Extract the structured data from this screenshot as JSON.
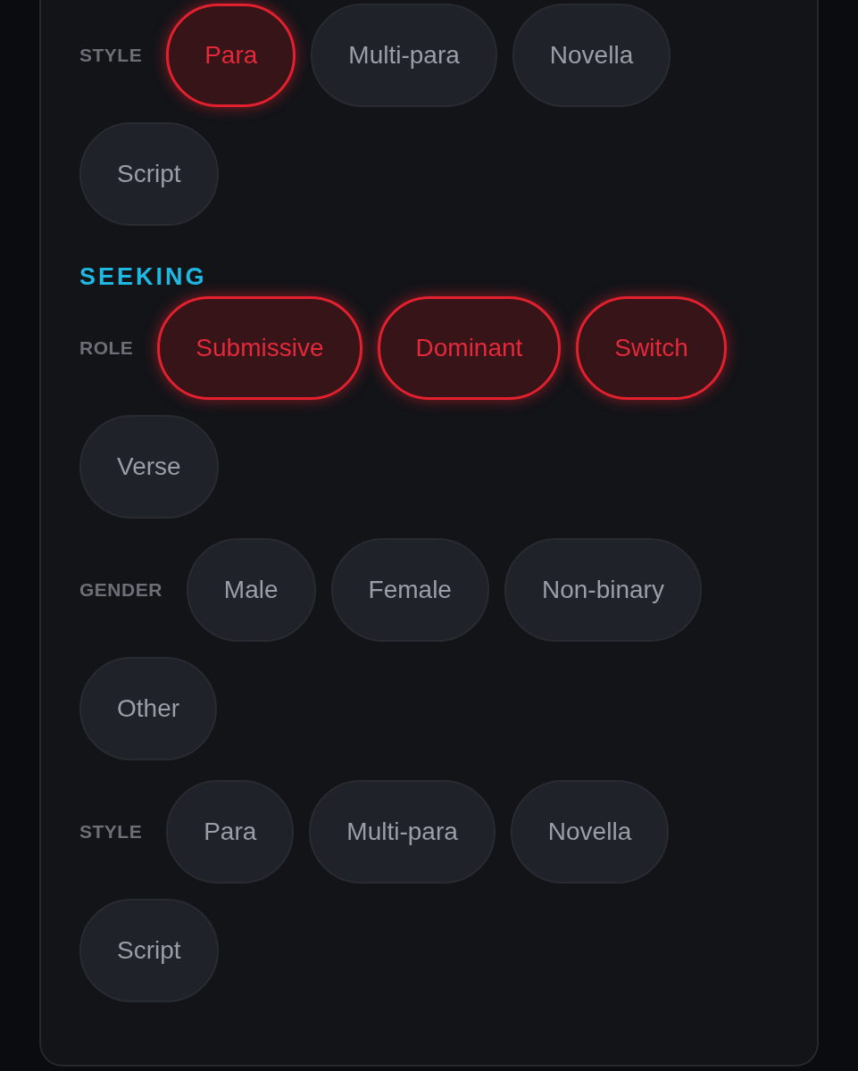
{
  "sections": [
    {
      "groups": [
        {
          "label": "STYLE",
          "options": [
            {
              "label": "Para",
              "selected": true
            },
            {
              "label": "Multi-para",
              "selected": false
            },
            {
              "label": "Novella",
              "selected": false
            },
            {
              "label": "Script",
              "selected": false
            }
          ]
        }
      ]
    },
    {
      "heading": "SEEKING",
      "groups": [
        {
          "label": "ROLE",
          "options": [
            {
              "label": "Submissive",
              "selected": true
            },
            {
              "label": "Dominant",
              "selected": true
            },
            {
              "label": "Switch",
              "selected": true
            },
            {
              "label": "Verse",
              "selected": false
            }
          ]
        },
        {
          "label": "GENDER",
          "options": [
            {
              "label": "Male",
              "selected": false
            },
            {
              "label": "Female",
              "selected": false
            },
            {
              "label": "Non-binary",
              "selected": false
            },
            {
              "label": "Other",
              "selected": false
            }
          ]
        },
        {
          "label": "STYLE",
          "options": [
            {
              "label": "Para",
              "selected": false
            },
            {
              "label": "Multi-para",
              "selected": false
            },
            {
              "label": "Novella",
              "selected": false
            },
            {
              "label": "Script",
              "selected": false
            }
          ]
        }
      ]
    }
  ]
}
